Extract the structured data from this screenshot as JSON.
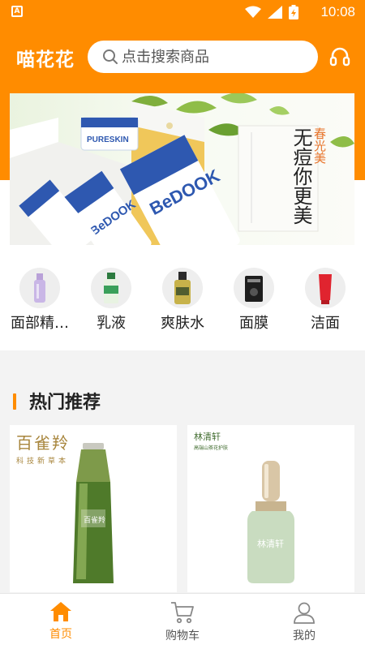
{
  "status_bar": {
    "app_badge": "A",
    "time": "10:08"
  },
  "header": {
    "app_title": "喵花花",
    "search_placeholder": "点击搜索商品",
    "icons": {
      "search": "search-icon",
      "service": "headset-icon"
    }
  },
  "banner": {
    "tag": "春光美",
    "headline": "无痘你更美",
    "brand_text": "PURESKIN",
    "product_text": "BeDOOK"
  },
  "categories": [
    {
      "label": "面部精…",
      "icon": "serum-bottle"
    },
    {
      "label": "乳液",
      "icon": "lotion-bottle"
    },
    {
      "label": "爽肤水",
      "icon": "toner-bottle"
    },
    {
      "label": "面膜",
      "icon": "face-mask"
    },
    {
      "label": "洁面",
      "icon": "cleanser-tube"
    }
  ],
  "hot": {
    "title": "热门推荐",
    "products": [
      {
        "brand": "百雀羚",
        "tagline": "科技新草本",
        "bottle_label": "百雀羚"
      },
      {
        "brand": "林清轩",
        "tagline": "高端山茶花护肤",
        "bottle_label": "林清轩"
      }
    ]
  },
  "bottom_nav": {
    "tabs": [
      {
        "label": "首页",
        "icon": "home-icon",
        "active": true
      },
      {
        "label": "购物车",
        "icon": "cart-icon",
        "active": false
      },
      {
        "label": "我的",
        "icon": "user-icon",
        "active": false
      }
    ]
  },
  "colors": {
    "accent": "#ff8c00",
    "background": "#f3f3f3"
  }
}
